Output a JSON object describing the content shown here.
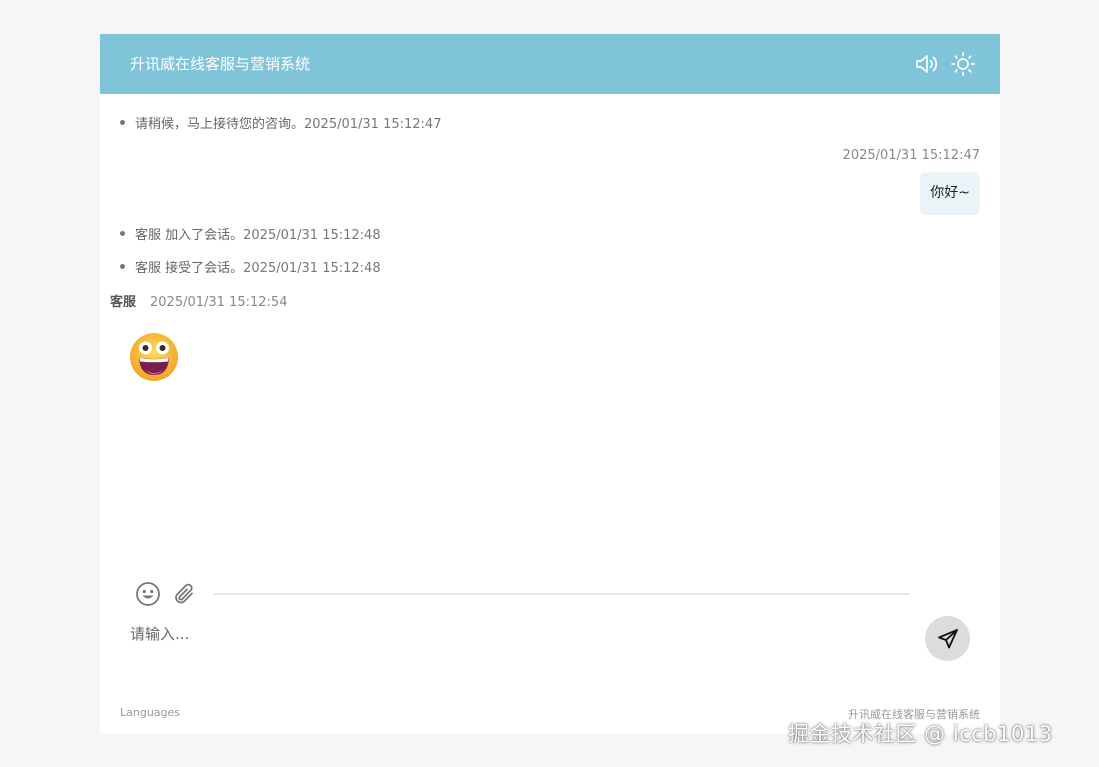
{
  "header": {
    "title": "升讯威在线客服与营销系统",
    "icons": [
      "speaker-icon",
      "sun-icon"
    ],
    "background": "#80c4da"
  },
  "messages": {
    "system1": {
      "text": "请稍候，马上接待您的咨询。",
      "time": "2025/01/31 15:12:47"
    },
    "user1": {
      "time": "2025/01/31 15:12:47",
      "text": "你好~"
    },
    "system2": {
      "text": "客服 加入了会话。",
      "time": "2025/01/31 15:12:48"
    },
    "system3": {
      "text": "客服 接受了会话。",
      "time": "2025/01/31 15:12:48"
    },
    "agent1": {
      "name": "客服",
      "time": "2025/01/31 15:12:54",
      "content_icon": "grinning-face-emoji"
    }
  },
  "composer": {
    "placeholder": "请输入...",
    "tools": [
      "smiley-icon",
      "paperclip-icon"
    ],
    "send_icon": "send-icon"
  },
  "footer": {
    "languages_label": "Languages",
    "brand": "升讯威在线客服与营销系统"
  },
  "watermark": "掘金技术社区 @ iccb1013"
}
